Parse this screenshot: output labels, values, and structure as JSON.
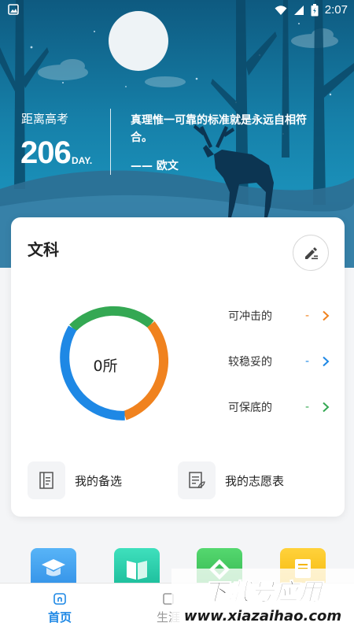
{
  "status_bar": {
    "time": "2:07",
    "icons": [
      "image-icon",
      "wifi-icon",
      "signal-icon",
      "battery-icon"
    ]
  },
  "hero": {
    "countdown_label": "距离高考",
    "countdown_value": "206",
    "countdown_unit": "DAY.",
    "quote": "真理惟一可靠的标准就是永远自相符合。",
    "quote_author": "—— 欧文"
  },
  "card": {
    "title": "文科",
    "edit_icon": "edit-icon",
    "donut_center": "0所",
    "categories": [
      {
        "label": "可冲击的",
        "value": "-",
        "color": "#f0821e"
      },
      {
        "label": "较稳妥的",
        "value": "-",
        "color": "#1e88e5"
      },
      {
        "label": "可保底的",
        "value": "-",
        "color": "#34a853"
      }
    ],
    "quick_links": [
      {
        "label": "我的备选",
        "icon": "list-doc-icon"
      },
      {
        "label": "我的志愿表",
        "icon": "edit-doc-icon"
      }
    ]
  },
  "features": [
    {
      "icon": "graduation-cap-icon",
      "color": "#3aa0f0"
    },
    {
      "icon": "book-icon",
      "color": "#1ec7a5"
    },
    {
      "icon": "diamond-icon",
      "color": "#3cc65a"
    },
    {
      "icon": "document-icon",
      "color": "#f7c21b"
    }
  ],
  "bottom_nav": [
    {
      "label": "首页",
      "icon": "home-icon",
      "active": true
    },
    {
      "label": "生涯",
      "icon": "career-icon",
      "active": false
    }
  ],
  "watermark": {
    "title": "下载号应用",
    "url": "www.xiazaihao.com"
  },
  "colors": {
    "rush": "#f0821e",
    "stable": "#1e88e5",
    "safe": "#34a853",
    "nav_active": "#1e88e5"
  }
}
